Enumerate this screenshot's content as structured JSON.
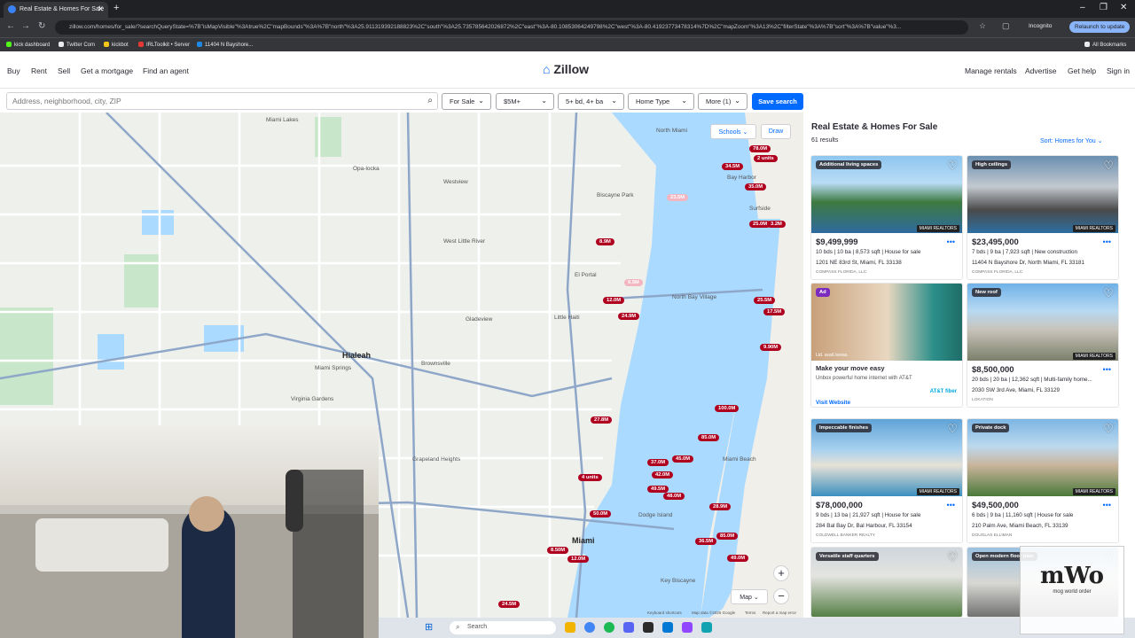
{
  "browser": {
    "tab_title": "Real Estate & Homes For Sale",
    "url": "zillow.com/homes/for_sale/?searchQueryState=%7B\"isMapVisible\"%3Atrue%2C\"mapBounds\"%3A%7B\"north\"%3A25.911319392188823%2C\"south\"%3A25.735785642026872%2C\"east\"%3A-80.10853064249798%2C\"west\"%3A-80.41923773478314%7D%2C\"mapZoom\"%3A13%2C\"filterState\"%3A%7B\"sort\"%3A%7B\"value\"%3...",
    "incognito": "Incognito",
    "relaunch": "Relaunch to update",
    "bookmarks": [
      "kick dashboard",
      "Twitter Com",
      "kickbot",
      "IRLToolkit • Server",
      "11404 N Bayshore..."
    ],
    "all_bookmarks": "All Bookmarks"
  },
  "header": {
    "left_nav": [
      "Buy",
      "Rent",
      "Sell",
      "Get a mortgage",
      "Find an agent"
    ],
    "logo": "Zillow",
    "right_nav": [
      "Manage rentals",
      "Advertise",
      "Get help",
      "Sign in"
    ]
  },
  "filters": {
    "search_placeholder": "Address, neighborhood, city, ZIP",
    "for_sale": "For Sale",
    "price": "$5M+",
    "beds_baths": "5+ bd, 4+ ba",
    "home_type": "Home Type",
    "more": "More (1)",
    "save_search": "Save search"
  },
  "map": {
    "schools": "Schools",
    "draw": "Draw",
    "map_type": "Map",
    "labels": [
      "Miami Lakes",
      "Opa-locka",
      "Westview",
      "North Miami",
      "Biscayne Park",
      "Bay Harbor",
      "Surfside",
      "El Portal",
      "West Little River",
      "Gladeview",
      "Hialeah",
      "Miami Springs",
      "Brownsville",
      "Little Haiti",
      "North Bay Village",
      "Miami Beach",
      "Miami",
      "Dodge Island",
      "Grapeland Heights",
      "Key Biscayne",
      "Virginia Gardens"
    ],
    "pins": [
      "78.0M",
      "34.5M",
      "2 units",
      "35.0M",
      "23.5M",
      "25.0M",
      "3.2M",
      "8.9M",
      "9.5M",
      "12.0M",
      "24.9M",
      "25.5M",
      "17.5M",
      "9.90M",
      "100.0M",
      "27.8M",
      "85.0M",
      "45.0M",
      "37.0M",
      "42.0M",
      "49.5M",
      "48.0M",
      "4 units",
      "50.0M",
      "28.9M",
      "85.0M",
      "36.5M",
      "49.0M",
      "8.50M",
      "12.0M",
      "24.5M"
    ],
    "footer": [
      "Keyboard shortcuts",
      "Map data ©2025 Google",
      "Terms",
      "Report a map error"
    ]
  },
  "results": {
    "title": "Real Estate & Homes For Sale",
    "count": "61 results",
    "sort": "Sort: Homes for You",
    "cards": [
      {
        "badge": "Additional living spaces",
        "price": "$9,499,999",
        "facts": "10 bds | 10 ba | 8,573 sqft | House for sale",
        "address": "1201 NE 83rd St, Miami, FL 33138",
        "broker": "COMPASS FLORIDA, LLC"
      },
      {
        "badge": "High ceilings",
        "price": "$23,495,000",
        "facts": "7 bds | 9 ba | 7,923 sqft | New construction",
        "address": "11404 N Bayshore Dr, North Miami, FL 33181",
        "broker": "COMPASS FLORIDA, LLC"
      },
      {
        "badge": "Ad",
        "title": "Make your move easy",
        "body": "Unbox powerful home internet with AT&T",
        "cta": "Visit Website",
        "fine": "Ltd. avail./areas.",
        "brand": "AT&T fiber"
      },
      {
        "badge": "New roof",
        "price": "$8,500,000",
        "facts": "20 bds | 20 ba | 12,362 sqft | Multi-family home...",
        "address": "2030 SW 3rd Ave, Miami, FL 33129",
        "broker": "LOKATION"
      },
      {
        "badge": "Impeccable finishes",
        "price": "$78,000,000",
        "facts": "9 bds | 13 ba | 21,927 sqft | House for sale",
        "address": "284 Bal Bay Dr, Bal Harbour, FL 33154",
        "broker": "COLDWELL BANKER REALTY"
      },
      {
        "badge": "Private dock",
        "price": "$49,500,000",
        "facts": "6 bds | 9 ba | 11,160 sqft | House for sale",
        "address": "210 Palm Ave, Miami Beach, FL 33139",
        "broker": "DOUGLAS ELLIMAN"
      },
      {
        "badge": "Versatile staff quarters"
      },
      {
        "badge": "Open modern floor plan"
      }
    ],
    "mls_logo": "MIAMI REALTORS"
  },
  "taskbar": {
    "search": "Search"
  },
  "watermark": "mog world order"
}
